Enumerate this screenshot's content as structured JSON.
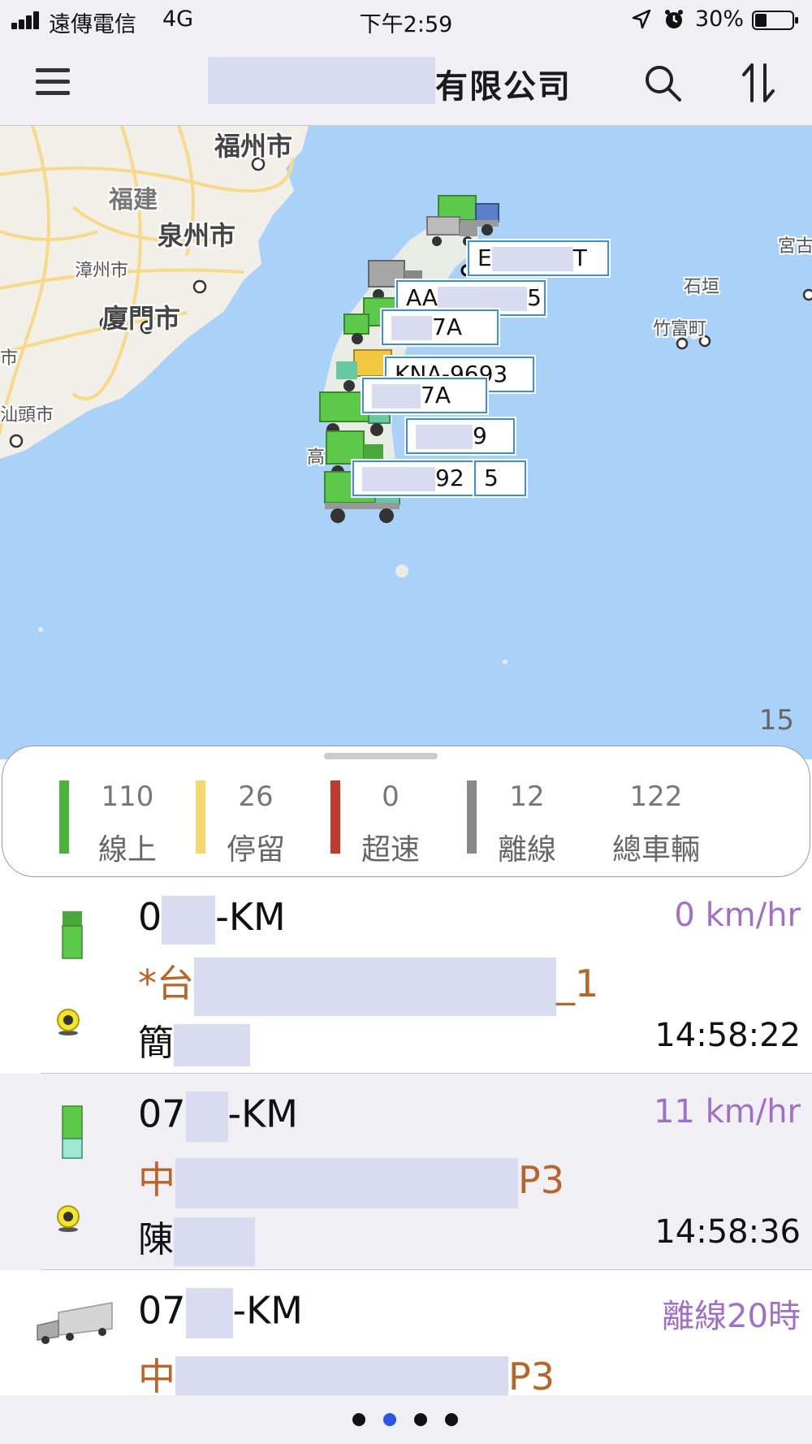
{
  "status_bar": {
    "carrier": "遠傳電信",
    "network": "4G",
    "time": "下午2:59",
    "battery": "30%"
  },
  "nav": {
    "title_suffix": "有限公司",
    "menu_icon": "hamburger-menu-icon",
    "search_icon": "search-icon",
    "sort_icon": "sort-icon"
  },
  "map": {
    "labels": {
      "fuzhou": "福州市",
      "fujian": "福建",
      "quanzhou": "泉州市",
      "zhangzhou": "漳州市",
      "xiamen": "廈門市",
      "city_edge": "市",
      "shantou": "汕頭市",
      "ishigaki": "石垣",
      "taketomi": "竹富町",
      "miyako": "宮古",
      "kaohsiung": "高"
    },
    "plates": [
      {
        "pre": "E",
        "post": "T"
      },
      {
        "pre": "AA",
        "post": "5"
      },
      {
        "pre": "",
        "post": "7A"
      },
      {
        "pre": "",
        "post": "KNA-9693"
      },
      {
        "pre": "",
        "post": "7A"
      },
      {
        "pre": "",
        "post": "9"
      },
      {
        "pre": "",
        "post": "92"
      },
      {
        "pre": "",
        "post": "5"
      }
    ],
    "zoom_count": "15"
  },
  "summary": {
    "online": {
      "value": "110",
      "label": "線上",
      "color": "#4bb33a"
    },
    "stopped": {
      "value": "26",
      "label": "停留",
      "color": "#f5d76e"
    },
    "speeding": {
      "value": "0",
      "label": "超速",
      "color": "#c0392b"
    },
    "offline": {
      "value": "12",
      "label": "離線",
      "color": "#888888"
    },
    "total": {
      "value": "122",
      "label": "總車輛"
    }
  },
  "vehicles": [
    {
      "plate_pre": "0",
      "plate_post": "-KM",
      "speed": "0 km/hr",
      "route_pre": "*台",
      "route_post": "_1",
      "driver": "簡",
      "time": "14:58:22",
      "icon": "green-truck-icon"
    },
    {
      "plate_pre": "07",
      "plate_post": "-KM",
      "speed": "11 km/hr",
      "route_pre": "中",
      "route_post": "P3",
      "driver": "陳",
      "time": "14:58:36",
      "icon": "green-truck-icon"
    },
    {
      "plate_pre": "07",
      "plate_post": "-KM",
      "speed": "離線20時",
      "route_pre": "中",
      "route_post": "P3",
      "driver": "",
      "time": "",
      "icon": "grey-truck-icon"
    }
  ],
  "pager": {
    "count": 4,
    "active": 2
  }
}
